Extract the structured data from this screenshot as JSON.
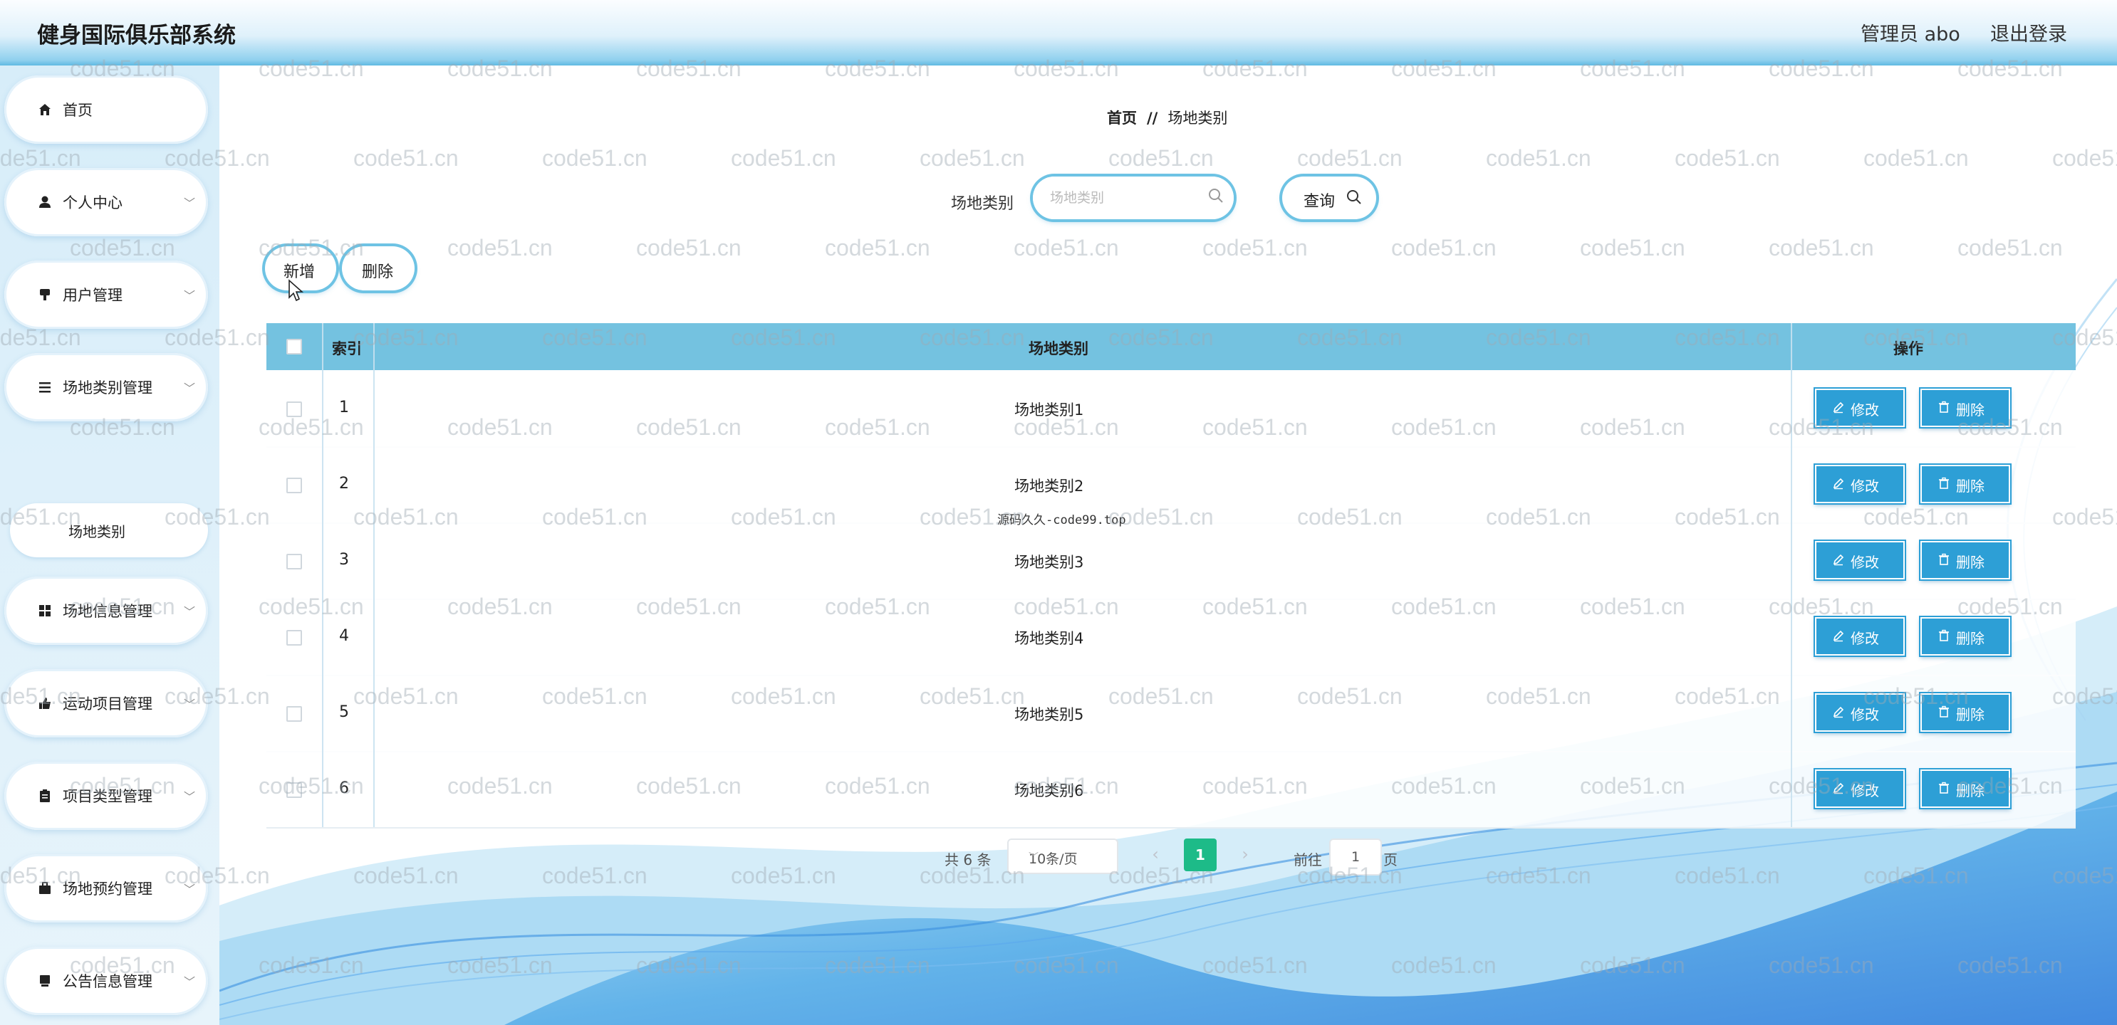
{
  "header": {
    "app_title": "健身国际俱乐部系统",
    "admin_label": "管理员 abo",
    "logout_label": "退出登录"
  },
  "sidebar": {
    "items": [
      {
        "label": "首页",
        "icon": "home-icon",
        "expandable": false
      },
      {
        "label": "个人中心",
        "icon": "user-icon",
        "expandable": true
      },
      {
        "label": "用户管理",
        "icon": "user-admin-icon",
        "expandable": true
      },
      {
        "label": "场地类别管理",
        "icon": "list-icon",
        "expandable": true
      },
      {
        "label": "场地信息管理",
        "icon": "grid-icon",
        "expandable": true
      },
      {
        "label": "运动项目管理",
        "icon": "thumb-icon",
        "expandable": true
      },
      {
        "label": "项目类型管理",
        "icon": "clipboard-icon",
        "expandable": true
      },
      {
        "label": "场地预约管理",
        "icon": "briefcase-icon",
        "expandable": true
      },
      {
        "label": "公告信息管理",
        "icon": "note-icon",
        "expandable": true
      }
    ],
    "sub_item": "场地类别"
  },
  "breadcrumb": {
    "home": "首页",
    "separator": "//",
    "current": "场地类别"
  },
  "search": {
    "label": "场地类别",
    "placeholder": "场地类别",
    "value": "",
    "button_label": "查询"
  },
  "toolbar": {
    "add_label": "新增",
    "delete_label": "删除"
  },
  "table": {
    "columns": [
      "索引",
      "场地类别",
      "操作"
    ],
    "rows": [
      {
        "index": "1",
        "name": "场地类别1"
      },
      {
        "index": "2",
        "name": "场地类别2"
      },
      {
        "index": "3",
        "name": "场地类别3"
      },
      {
        "index": "4",
        "name": "场地类别4"
      },
      {
        "index": "5",
        "name": "场地类别5"
      },
      {
        "index": "6",
        "name": "场地类别6"
      }
    ],
    "edit_label": "修改",
    "delete_label": "删除"
  },
  "overlay_text": "源码久久-code99.top",
  "pagination": {
    "total": "共 6 条",
    "page_size": "10条/页",
    "current_page": "1",
    "goto_label": "前往",
    "goto_value": "1",
    "page_suffix": "页"
  },
  "watermark": "code51.cn",
  "colors": {
    "header_gradient_end": "#5fb9e2",
    "table_header": "#74c2e0",
    "action_button": "#2d9fd6",
    "pager_active": "#1dbb88"
  }
}
